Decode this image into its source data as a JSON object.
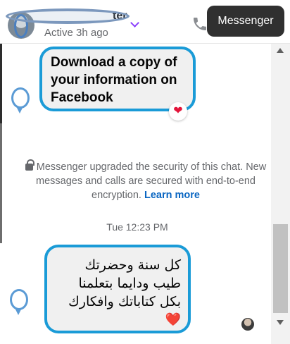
{
  "header": {
    "contact_name_visible": "ter",
    "status": "Active 3h ago"
  },
  "tooltip": {
    "text": "Messenger"
  },
  "messages": [
    {
      "text": "Download a copy of your information on Facebook",
      "reaction": "❤"
    },
    {
      "text": "كل سنة وحضرتك طيب ودايما بتعلمنا بكل كتاباتك وافكارك",
      "emoji": "❤️"
    }
  ],
  "security_notice": {
    "text": "Messenger upgraded the security of this chat. New messages and calls are secured with end-to-end encryption.",
    "link": "Learn more"
  },
  "timestamp": "Tue 12:23 PM",
  "icons": {
    "phone": "phone-icon",
    "close": "close-icon",
    "lock": "lock-icon",
    "chevron": "chevron-down-icon"
  },
  "colors": {
    "highlight": "#1a9bd7",
    "link": "#0a66c2",
    "accent": "#8a3ffc",
    "heart": "#e3143a"
  }
}
